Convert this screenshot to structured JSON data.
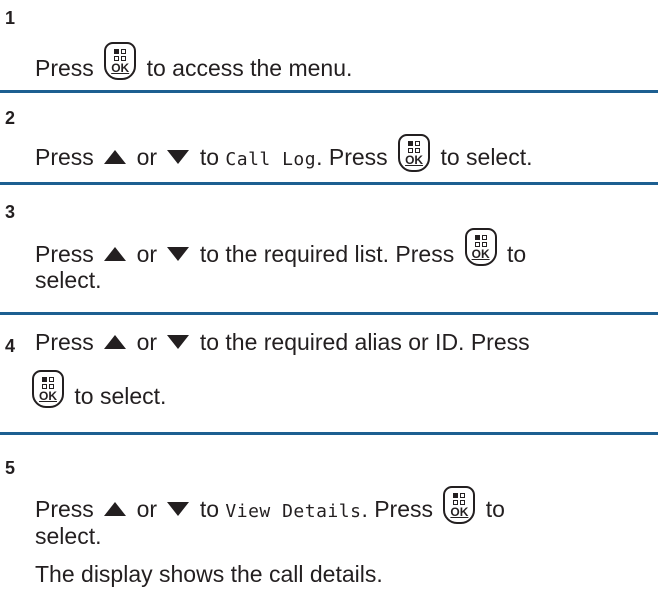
{
  "steps": [
    {
      "number": "1",
      "text_press": "Press",
      "text_rest": "to access the menu."
    },
    {
      "number": "2",
      "text_press": "Press",
      "text_or": "or",
      "text_to": "to",
      "menu_item": "Call Log",
      "text_period_press": ". Press",
      "text_rest": "to select."
    },
    {
      "number": "3",
      "text_press": "Press",
      "text_or": "or",
      "text_mid": "to the required list. Press",
      "text_to": "to",
      "text_line2": "select."
    },
    {
      "number": "4",
      "text_press": "Press",
      "text_or": "or",
      "text_mid": "to the required alias or ID. Press",
      "text_line2": "to select."
    },
    {
      "number": "5",
      "text_press": "Press",
      "text_or": "or",
      "text_to": "to",
      "menu_item": "View Details",
      "text_period_press": ". Press",
      "text_to2": "to",
      "text_line2": "select.",
      "result": "The display shows the call details."
    }
  ],
  "ok_key": {
    "label": "OK"
  },
  "icons": {
    "up": "up-arrow-icon",
    "down": "down-arrow-icon",
    "ok": "menu-ok-key-icon"
  },
  "colors": {
    "separator": "#1d5f91",
    "text": "#231f20"
  }
}
